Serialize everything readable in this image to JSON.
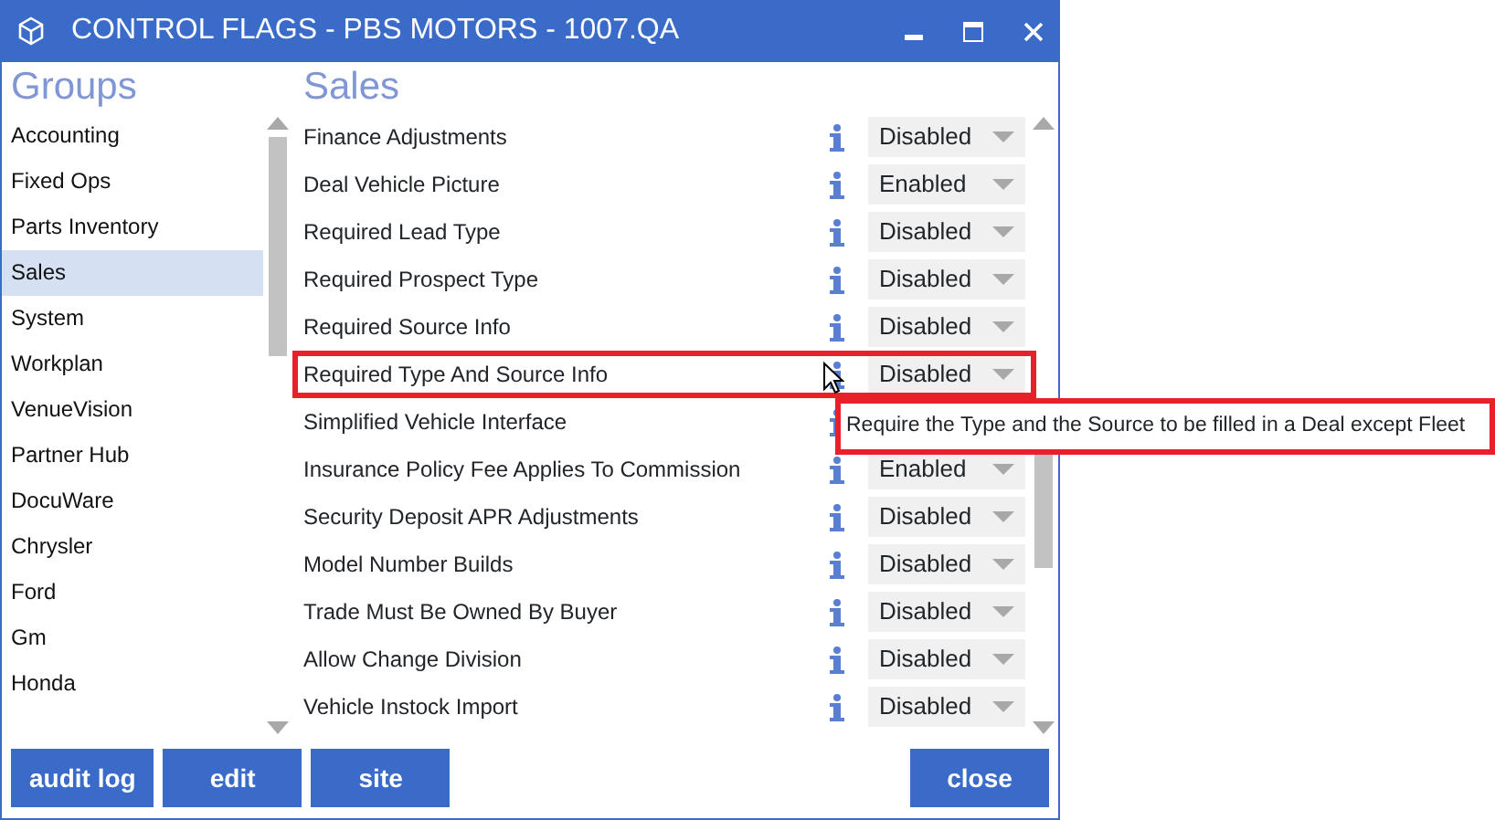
{
  "window": {
    "title": "CONTROL FLAGS - PBS MOTORS - 1007.QA"
  },
  "groups": {
    "heading": "Groups",
    "items": [
      {
        "label": "Accounting",
        "selected": false
      },
      {
        "label": "Fixed Ops",
        "selected": false
      },
      {
        "label": "Parts Inventory",
        "selected": false
      },
      {
        "label": "Sales",
        "selected": true
      },
      {
        "label": "System",
        "selected": false
      },
      {
        "label": "Workplan",
        "selected": false
      },
      {
        "label": "VenueVision",
        "selected": false
      },
      {
        "label": "Partner Hub",
        "selected": false
      },
      {
        "label": "DocuWare",
        "selected": false
      },
      {
        "label": "Chrysler",
        "selected": false
      },
      {
        "label": "Ford",
        "selected": false
      },
      {
        "label": "Gm",
        "selected": false
      },
      {
        "label": "Honda",
        "selected": false
      }
    ]
  },
  "flags": {
    "heading": "Sales",
    "rows": [
      {
        "label": "Finance Adjustments",
        "value": "Disabled",
        "highlighted": false
      },
      {
        "label": "Deal Vehicle Picture",
        "value": "Enabled",
        "highlighted": false
      },
      {
        "label": "Required Lead Type",
        "value": "Disabled",
        "highlighted": false
      },
      {
        "label": "Required Prospect Type",
        "value": "Disabled",
        "highlighted": false
      },
      {
        "label": "Required Source Info",
        "value": "Disabled",
        "highlighted": false
      },
      {
        "label": "Required Type And Source Info",
        "value": "Disabled",
        "highlighted": true
      },
      {
        "label": "Simplified Vehicle Interface",
        "highlighted": false
      },
      {
        "label": "Insurance Policy Fee Applies To Commission",
        "value": "Enabled",
        "highlighted": false
      },
      {
        "label": "Security Deposit APR Adjustments",
        "value": "Disabled",
        "highlighted": false
      },
      {
        "label": "Model Number Builds",
        "value": "Disabled",
        "highlighted": false
      },
      {
        "label": "Trade Must Be Owned By Buyer",
        "value": "Disabled",
        "highlighted": false
      },
      {
        "label": "Allow Change Division",
        "value": "Disabled",
        "highlighted": false
      },
      {
        "label": "Vehicle Instock Import",
        "value": "Disabled",
        "highlighted": false
      }
    ]
  },
  "tooltip": {
    "text": "Require the Type and the Source to be filled in a Deal except Fleet"
  },
  "left_buttons": [
    {
      "label": "audit log"
    },
    {
      "label": "edit"
    },
    {
      "label": "site"
    }
  ],
  "right_buttons": [
    {
      "label": "close"
    }
  ]
}
